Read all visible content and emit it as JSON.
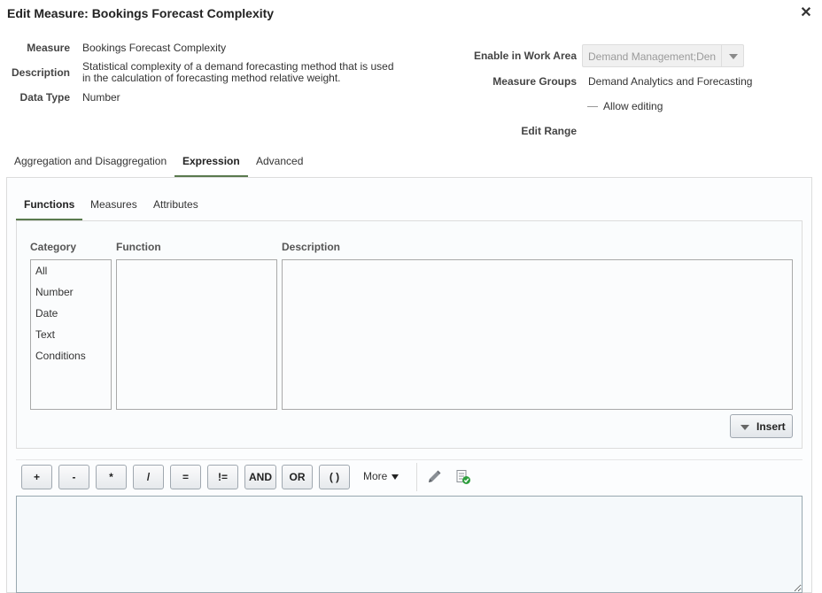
{
  "dialog": {
    "title": "Edit Measure: Bookings Forecast Complexity",
    "close_glyph": "✕"
  },
  "fields": {
    "measure_label": "Measure",
    "measure_value": "Bookings Forecast Complexity",
    "description_label": "Description",
    "description_line1": "Statistical complexity of a demand forecasting method that is used",
    "description_line2": "in the calculation of forecasting method relative weight.",
    "data_type_label": "Data Type",
    "data_type_value": "Number",
    "work_area_label": "Enable in Work Area",
    "work_area_value": "Demand Management;Den",
    "measure_groups_label": "Measure Groups",
    "measure_groups_value": "Demand Analytics and Forecasting",
    "allow_editing_label": "Allow editing",
    "edit_range_label": "Edit Range"
  },
  "main_tabs": [
    {
      "label": "Aggregation and Disaggregation",
      "active": false
    },
    {
      "label": "Expression",
      "active": true
    },
    {
      "label": "Advanced",
      "active": false
    }
  ],
  "sub_tabs": [
    {
      "label": "Functions",
      "active": true
    },
    {
      "label": "Measures",
      "active": false
    },
    {
      "label": "Attributes",
      "active": false
    }
  ],
  "columns": {
    "category": "Category",
    "function": "Function",
    "description": "Description"
  },
  "categories": [
    "All",
    "Number",
    "Date",
    "Text",
    "Conditions"
  ],
  "insert_label": "Insert",
  "operators": [
    "+",
    "-",
    "*",
    "/",
    "=",
    "!=",
    "AND",
    "OR",
    "( )"
  ],
  "more_label": "More",
  "icons": {
    "edit": "pencil-icon",
    "validate": "validate-document-icon"
  },
  "colors": {
    "tab_underline": "#5a7a4e",
    "validate_check": "#2e9e3e"
  }
}
